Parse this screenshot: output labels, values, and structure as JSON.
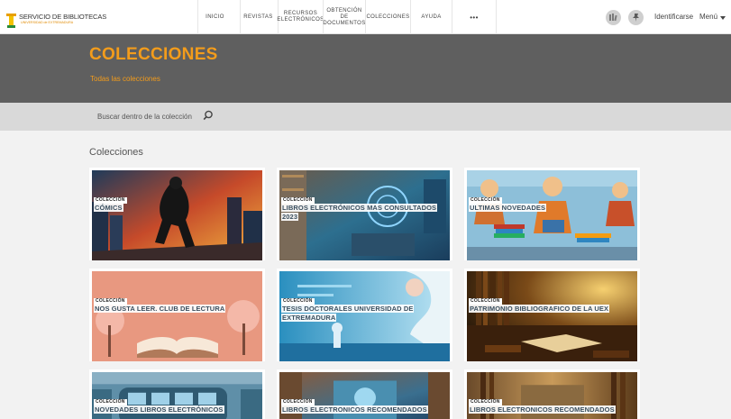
{
  "logo": {
    "title": "SERVICIO DE BIBLIOTECAS",
    "subtitle": "UNIVERSIDAD de EXTREMADURA"
  },
  "nav": {
    "items": [
      {
        "label": "INICIO"
      },
      {
        "label": "REVISTAS"
      },
      {
        "label": "RECURSOS ELECTRÓNICOS",
        "lines": [
          "RECURSOS",
          "ELECTRÓNICOS"
        ]
      },
      {
        "label": "OBTENCIÓN DE DOCUMENTOS",
        "lines": [
          "OBTENCIÓN",
          "DE",
          "DOCUMENTOS"
        ]
      },
      {
        "label": "COLECCIONES"
      },
      {
        "label": "AYUDA"
      },
      {
        "label": "•••"
      }
    ],
    "icons": [
      "books-icon",
      "pin-icon"
    ],
    "login_label": "Identificarse",
    "menu_label": "Menú"
  },
  "header": {
    "title": "COLECCIONES",
    "subtitle": "Todas las colecciones"
  },
  "search": {
    "placeholder": "Buscar dentro de la colección"
  },
  "content": {
    "section_title": "Colecciones",
    "tag_label": "COLECCIÓN",
    "cards": [
      {
        "title": "CÓMICS"
      },
      {
        "title": "LIBROS ELECTRÓNICOS MAS CONSULTADOS 2023"
      },
      {
        "title": "ULTIMAS NOVEDADES"
      },
      {
        "title": "NOS GUSTA LEER. CLUB DE LECTURA"
      },
      {
        "title": "TESIS DOCTORALES UNIVERSIDAD DE EXTREMADURA"
      },
      {
        "title": "PATRIMONIO BIBLIOGRAFICO DE LA UEX"
      },
      {
        "title": "NOVEDADES LIBROS ELECTRÓNICOS"
      },
      {
        "title": "LIBROS ELECTRONICOS RECOMENDADOS"
      },
      {
        "title": "LIBROS ELECTRONICOS RECOMENDADOS"
      }
    ]
  },
  "colors": {
    "accent": "#f39c1b",
    "header_bg": "#5f5f5f",
    "search_bg": "#d9d9d9",
    "page_bg": "#f2f2f2",
    "card_title": "#3a4f5f"
  }
}
